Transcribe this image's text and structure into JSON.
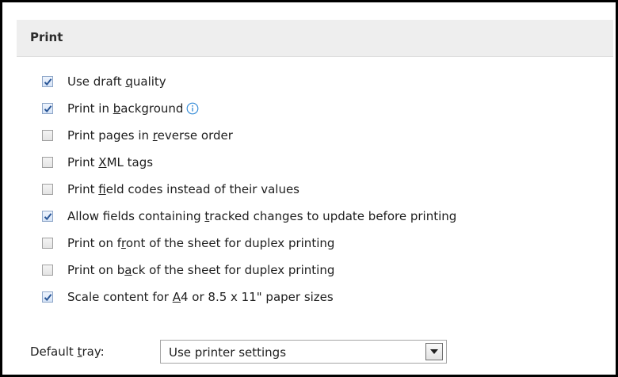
{
  "section": {
    "title": "Print"
  },
  "options": [
    {
      "before": "Use draft ",
      "key": "q",
      "after": "uality",
      "checked": true
    },
    {
      "before": "Print in ",
      "key": "b",
      "after": "ackground",
      "checked": true,
      "info": true
    },
    {
      "before": "Print pages in ",
      "key": "r",
      "after": "everse order",
      "checked": false
    },
    {
      "before": "Print ",
      "key": "X",
      "after": "ML tags",
      "checked": false
    },
    {
      "before": "Print ",
      "key": "f",
      "after": "ield codes instead of their values",
      "checked": false
    },
    {
      "before": "Allow fields containing ",
      "key": "t",
      "after": "racked changes to update before printing",
      "checked": true
    },
    {
      "before": "Print on f",
      "key": "r",
      "after": "ont of the sheet for duplex printing",
      "checked": false
    },
    {
      "before": "Print on b",
      "key": "a",
      "after": "ck of the sheet for duplex printing",
      "checked": false
    },
    {
      "before": "Scale content for ",
      "key": "A",
      "after": "4 or 8.5 x 11\" paper sizes",
      "checked": true
    }
  ],
  "tray": {
    "label_before": "Default ",
    "label_key": "t",
    "label_after": "ray:",
    "value": "Use printer settings"
  },
  "icons": {
    "info": "info-icon",
    "checkmark": "checkmark-icon",
    "dropdown": "chevron-down-icon"
  },
  "colors": {
    "check": "#2b5797",
    "info": "#3a8fd9",
    "header_bg": "#eeeeee"
  }
}
